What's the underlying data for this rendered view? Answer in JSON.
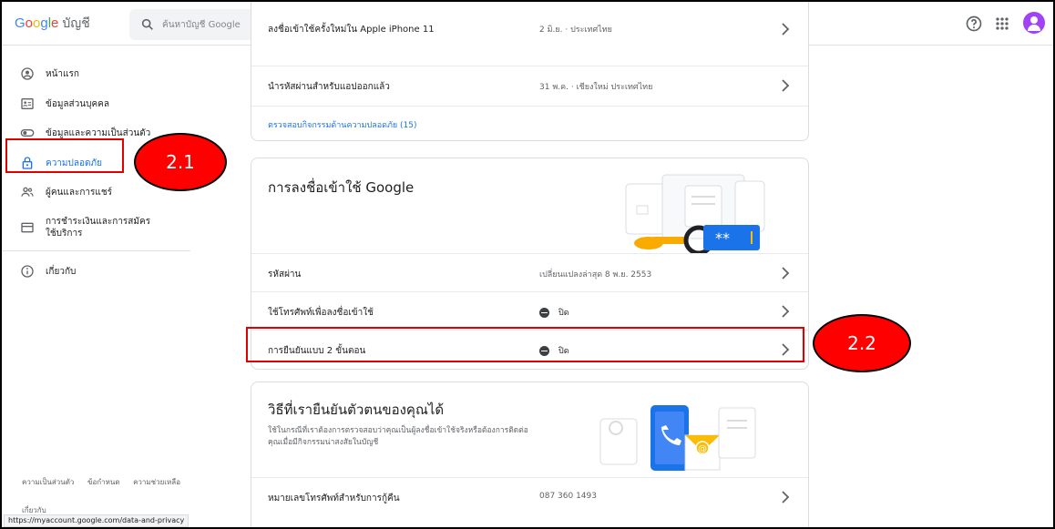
{
  "header": {
    "logo_word": "Google",
    "account_label": "บัญชี",
    "search_placeholder": "ค้นหาบัญชี Google",
    "help_icon": "help-circle-icon",
    "apps_icon": "apps-grid-icon",
    "avatar_icon": "account-avatar"
  },
  "sidebar": {
    "items": [
      {
        "label": "หน้าแรก",
        "icon": "home-circle-icon"
      },
      {
        "label": "ข้อมูลส่วนบุคคล",
        "icon": "id-card-icon"
      },
      {
        "label": "ข้อมูลและความเป็นส่วนตัว",
        "icon": "toggle-icon"
      },
      {
        "label": "ความปลอดภัย",
        "icon": "lock-icon"
      },
      {
        "label": "ผู้คนและการแชร์",
        "icon": "people-icon"
      },
      {
        "label": "การชำระเงินและการสมัครใช้บริการ",
        "icon": "credit-card-icon"
      },
      {
        "label": "เกี่ยวกับ",
        "icon": "info-icon"
      }
    ],
    "footer": [
      "ความเป็นส่วนตัว",
      "ข้อกำหนด",
      "ความช่วยเหลือ"
    ],
    "cut_text": "เกี่ยวกับ"
  },
  "status_url": "https://myaccount.google.com/data-and-privacy",
  "activity_card": {
    "rows": [
      {
        "key": "ลงชื่อเข้าใช้ครั้งใหม่ใน Apple iPhone 11",
        "value": "2 มิ.ย. · ประเทศไทย"
      },
      {
        "key": "นำรหัสผ่านสำหรับแอปออกแล้ว",
        "value": "31 พ.ค. · เชียงใหม่ ประเทศไทย"
      }
    ],
    "link": "ตรวจสอบกิจกรรมด้านความปลอดภัย (15)"
  },
  "signin_card": {
    "title": "การลงชื่อเข้าใช้ Google",
    "password_mask": "**",
    "rows": [
      {
        "key": "รหัสผ่าน",
        "value": "เปลี่ยนแปลงล่าสุด 8 พ.ย. 2553"
      },
      {
        "key": "ใช้โทรศัพท์เพื่อลงชื่อเข้าใช้",
        "value": "ปิด"
      },
      {
        "key": "การยืนยันแบบ 2 ขั้นตอน",
        "value": "ปิด"
      }
    ]
  },
  "verify_card": {
    "title": "วิธีที่เรายืนยันตัวตนของคุณได้",
    "desc_line1": "ใช้ในกรณีที่เราต้องการตรวจสอบว่าคุณเป็นผู้ลงชื่อเข้าใช้จริงหรือต้องการติดต่อ",
    "desc_line2": "คุณเมื่อมีกิจกรรมน่าสงสัยในบัญชี",
    "rows": [
      {
        "key": "หมายเลขโทรศัพท์สำหรับการกู้คืน",
        "value": "087 360 1493"
      }
    ]
  },
  "callouts": {
    "c1": "2.1",
    "c2": "2.2"
  },
  "colors": {
    "accent": "#1a73e8",
    "callout": "#ff0000",
    "card_border": "#dadce0"
  }
}
